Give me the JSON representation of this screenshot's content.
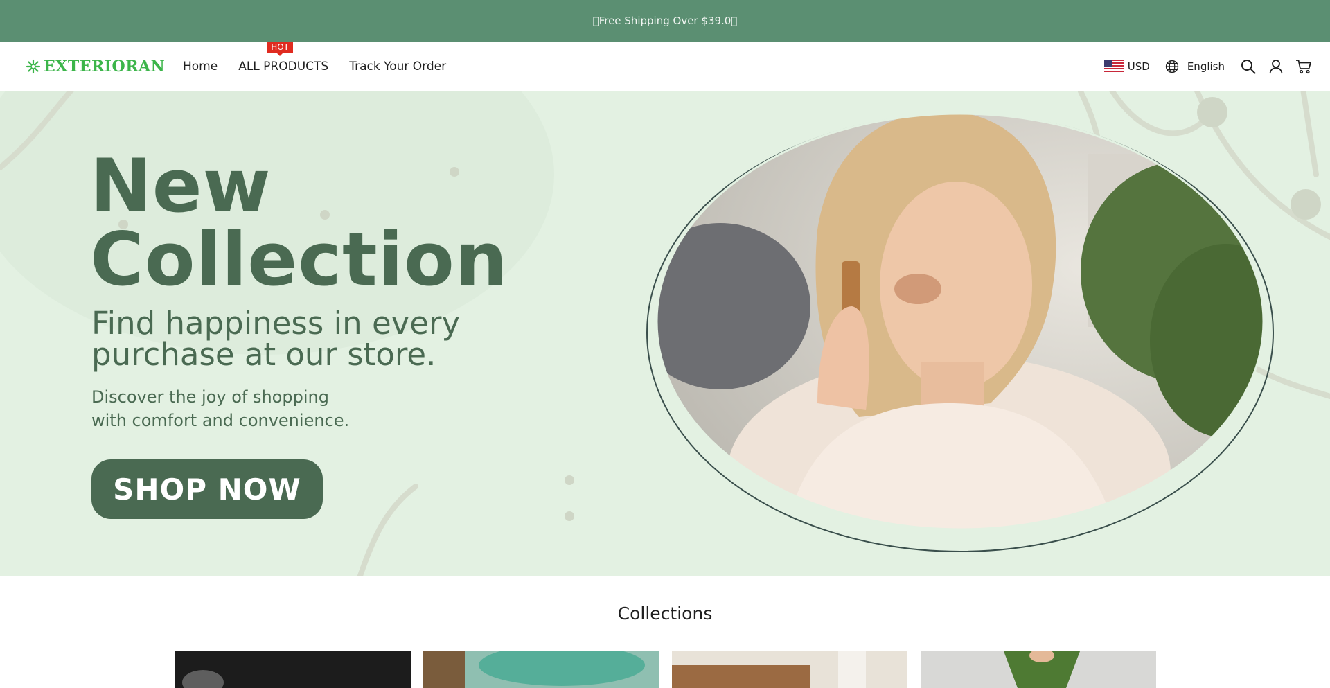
{
  "announcement": {
    "text": "Free Shipping Over $39.0"
  },
  "header": {
    "logo": "EXTERIORAN",
    "nav": [
      {
        "label": "Home"
      },
      {
        "label": "ALL PRODUCTS",
        "badge": "HOT"
      },
      {
        "label": "Track Your Order"
      }
    ],
    "currency": "USD",
    "language": "English",
    "icons": [
      "globe-icon",
      "search-icon",
      "account-icon",
      "cart-icon"
    ]
  },
  "hero": {
    "title_line1": "New",
    "title_line2": "Collection",
    "subtitle": "Find happiness in every purchase at our store.",
    "desc_line1": "Discover the joy of shopping",
    "desc_line2": "with comfort and convenience.",
    "button": "SHOP NOW"
  },
  "collections": {
    "title": "Collections"
  },
  "colors": {
    "announcement_bg": "#5b8f72",
    "brand_green": "#3cb54a",
    "hero_bg": "#e3f1e2",
    "hero_text": "#4a6a52",
    "hot_badge": "#e02b20"
  }
}
